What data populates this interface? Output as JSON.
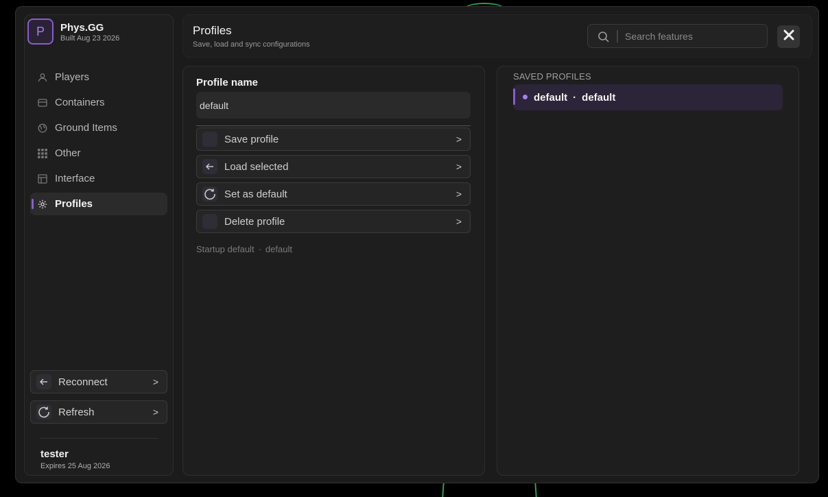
{
  "brand": {
    "logo_letter": "P",
    "name": "Phys.GG",
    "build": "Built Aug 23 2026"
  },
  "nav": {
    "items": [
      {
        "label": "Players",
        "icon": "user-icon"
      },
      {
        "label": "Containers",
        "icon": "container-icon"
      },
      {
        "label": "Ground Items",
        "icon": "globe-icon"
      },
      {
        "label": "Other",
        "icon": "grid-icon"
      },
      {
        "label": "Interface",
        "icon": "layout-icon"
      },
      {
        "label": "Profiles",
        "icon": "gear-icon",
        "active": true
      }
    ]
  },
  "sidebar_actions": {
    "reconnect": "Reconnect",
    "refresh": "Refresh"
  },
  "user": {
    "name": "tester",
    "expires": "Expires 25 Aug 2026"
  },
  "header": {
    "title": "Profiles",
    "subtitle": "Save, load and sync configurations",
    "search_placeholder": "Search features"
  },
  "profile_form": {
    "label": "Profile name",
    "value": "default",
    "actions": [
      {
        "label": "Save profile",
        "icon": "blank-icon"
      },
      {
        "label": "Load selected",
        "icon": "arrow-left-icon"
      },
      {
        "label": "Set as default",
        "icon": "refresh-icon"
      },
      {
        "label": "Delete profile",
        "icon": "blank-icon"
      }
    ],
    "startup_label": "Startup default",
    "startup_value": "default"
  },
  "saved_profiles": {
    "heading": "SAVED PROFILES",
    "items": [
      {
        "name": "default",
        "value": "default"
      }
    ]
  },
  "colors": {
    "accent": "#8a5cd1",
    "background": "#1b1b1b",
    "panel": "#1e1e1e"
  }
}
